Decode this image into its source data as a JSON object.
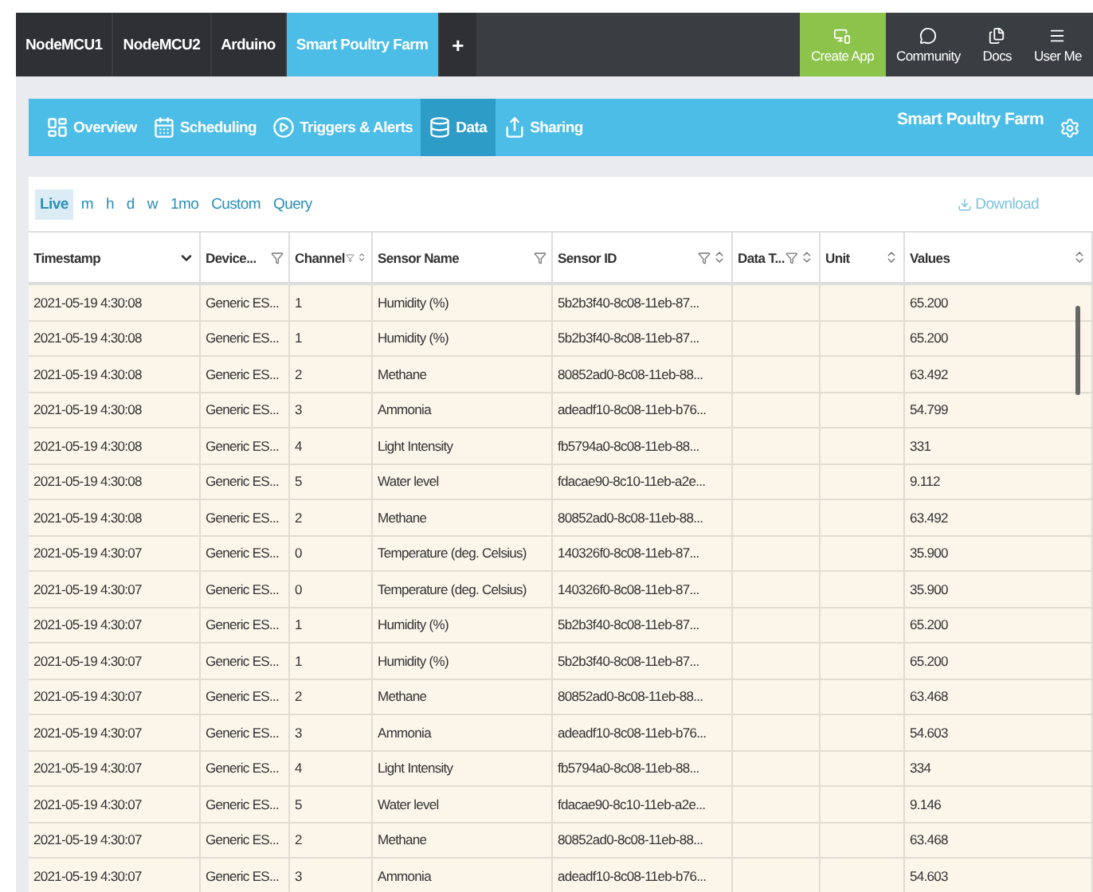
{
  "top_tabs": [
    {
      "label": "NodeMCU1",
      "selected": false
    },
    {
      "label": "NodeMCU2",
      "selected": false
    },
    {
      "label": "Arduino",
      "selected": false
    },
    {
      "label": "Smart Poultry Farm",
      "selected": true
    }
  ],
  "add_tab": "+",
  "top_actions": [
    {
      "label": "Create App",
      "kind": "create",
      "highlighted": true
    },
    {
      "label": "Community",
      "kind": "community",
      "highlighted": false
    },
    {
      "label": "Docs",
      "kind": "docs",
      "highlighted": false
    },
    {
      "label": "User Me",
      "kind": "menu",
      "highlighted": false
    }
  ],
  "nav": {
    "items": [
      {
        "label": "Overview",
        "kind": "overview",
        "selected": false
      },
      {
        "label": "Scheduling",
        "kind": "calendar",
        "selected": false
      },
      {
        "label": "Triggers & Alerts",
        "kind": "play",
        "selected": false
      },
      {
        "label": "Data",
        "kind": "database",
        "selected": true
      },
      {
        "label": "Sharing",
        "kind": "share",
        "selected": false
      }
    ],
    "title": "Smart Poultry Farm"
  },
  "ranges": [
    {
      "label": "Live",
      "selected": true
    },
    {
      "label": "m",
      "selected": false
    },
    {
      "label": "h",
      "selected": false
    },
    {
      "label": "d",
      "selected": false
    },
    {
      "label": "w",
      "selected": false
    },
    {
      "label": "1mo",
      "selected": false
    },
    {
      "label": "Custom",
      "selected": false
    },
    {
      "label": "Query",
      "selected": false
    }
  ],
  "download": "Download",
  "table": {
    "columns": [
      {
        "label": "Timestamp",
        "filter": false,
        "sortable": false,
        "sorted_desc": true
      },
      {
        "label": "Device...",
        "filter": true,
        "sortable": false,
        "sorted_desc": false
      },
      {
        "label": "Channel",
        "filter": true,
        "sortable": true,
        "sorted_desc": false
      },
      {
        "label": "Sensor Name",
        "filter": true,
        "sortable": false,
        "sorted_desc": false
      },
      {
        "label": "Sensor ID",
        "filter": true,
        "sortable": true,
        "sorted_desc": false
      },
      {
        "label": "Data T...",
        "filter": true,
        "sortable": true,
        "sorted_desc": false
      },
      {
        "label": "Unit",
        "filter": false,
        "sortable": true,
        "sorted_desc": false
      },
      {
        "label": "Values",
        "filter": false,
        "sortable": true,
        "sorted_desc": false
      }
    ],
    "rows": [
      {
        "timestamp": "2021-05-19 4:30:08",
        "device": "Generic ES...",
        "channel": "1",
        "sensor_name": "Humidity (%)",
        "sensor_id": "5b2b3f40-8c08-11eb-87...",
        "value": "65.200"
      },
      {
        "timestamp": "2021-05-19 4:30:08",
        "device": "Generic ES...",
        "channel": "1",
        "sensor_name": "Humidity (%)",
        "sensor_id": "5b2b3f40-8c08-11eb-87...",
        "value": "65.200"
      },
      {
        "timestamp": "2021-05-19 4:30:08",
        "device": "Generic ES...",
        "channel": "2",
        "sensor_name": "Methane",
        "sensor_id": "80852ad0-8c08-11eb-88...",
        "value": "63.492"
      },
      {
        "timestamp": "2021-05-19 4:30:08",
        "device": "Generic ES...",
        "channel": "3",
        "sensor_name": "Ammonia",
        "sensor_id": "adeadf10-8c08-11eb-b76...",
        "value": "54.799"
      },
      {
        "timestamp": "2021-05-19 4:30:08",
        "device": "Generic ES...",
        "channel": "4",
        "sensor_name": "Light Intensity",
        "sensor_id": "fb5794a0-8c08-11eb-88...",
        "value": "331"
      },
      {
        "timestamp": "2021-05-19 4:30:08",
        "device": "Generic ES...",
        "channel": "5",
        "sensor_name": "Water level",
        "sensor_id": "fdacae90-8c10-11eb-a2e...",
        "value": "9.112"
      },
      {
        "timestamp": "2021-05-19 4:30:08",
        "device": "Generic ES...",
        "channel": "2",
        "sensor_name": "Methane",
        "sensor_id": "80852ad0-8c08-11eb-88...",
        "value": "63.492"
      },
      {
        "timestamp": "2021-05-19 4:30:07",
        "device": "Generic ES...",
        "channel": "0",
        "sensor_name": "Temperature (deg. Celsius)",
        "sensor_id": "140326f0-8c08-11eb-87...",
        "value": "35.900"
      },
      {
        "timestamp": "2021-05-19 4:30:07",
        "device": "Generic ES...",
        "channel": "0",
        "sensor_name": "Temperature (deg. Celsius)",
        "sensor_id": "140326f0-8c08-11eb-87...",
        "value": "35.900"
      },
      {
        "timestamp": "2021-05-19 4:30:07",
        "device": "Generic ES...",
        "channel": "1",
        "sensor_name": "Humidity (%)",
        "sensor_id": "5b2b3f40-8c08-11eb-87...",
        "value": "65.200"
      },
      {
        "timestamp": "2021-05-19 4:30:07",
        "device": "Generic ES...",
        "channel": "1",
        "sensor_name": "Humidity (%)",
        "sensor_id": "5b2b3f40-8c08-11eb-87...",
        "value": "65.200"
      },
      {
        "timestamp": "2021-05-19 4:30:07",
        "device": "Generic ES...",
        "channel": "2",
        "sensor_name": "Methane",
        "sensor_id": "80852ad0-8c08-11eb-88...",
        "value": "63.468"
      },
      {
        "timestamp": "2021-05-19 4:30:07",
        "device": "Generic ES...",
        "channel": "3",
        "sensor_name": "Ammonia",
        "sensor_id": "adeadf10-8c08-11eb-b76...",
        "value": "54.603"
      },
      {
        "timestamp": "2021-05-19 4:30:07",
        "device": "Generic ES...",
        "channel": "4",
        "sensor_name": "Light Intensity",
        "sensor_id": "fb5794a0-8c08-11eb-88...",
        "value": "334"
      },
      {
        "timestamp": "2021-05-19 4:30:07",
        "device": "Generic ES...",
        "channel": "5",
        "sensor_name": "Water level",
        "sensor_id": "fdacae90-8c10-11eb-a2e...",
        "value": "9.146"
      },
      {
        "timestamp": "2021-05-19 4:30:07",
        "device": "Generic ES...",
        "channel": "2",
        "sensor_name": "Methane",
        "sensor_id": "80852ad0-8c08-11eb-88...",
        "value": "63.468"
      },
      {
        "timestamp": "2021-05-19 4:30:07",
        "device": "Generic ES...",
        "channel": "3",
        "sensor_name": "Ammonia",
        "sensor_id": "adeadf10-8c08-11eb-b76...",
        "value": "54.603"
      }
    ]
  }
}
